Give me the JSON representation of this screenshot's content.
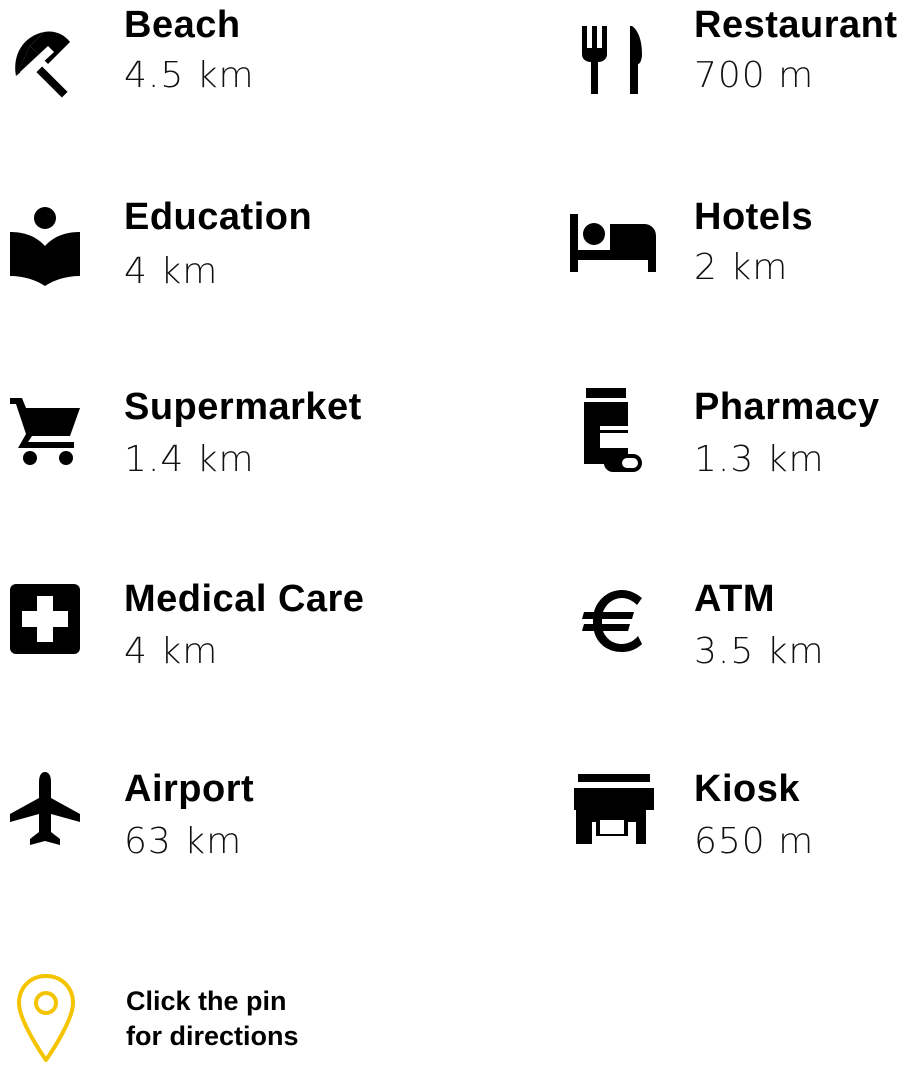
{
  "amenities": [
    {
      "name": "Beach",
      "distance": "4.5 km",
      "icon": "beach-umbrella-icon"
    },
    {
      "name": "Restaurant",
      "distance": "700 m",
      "icon": "restaurant-icon"
    },
    {
      "name": "Education",
      "distance": "4 km",
      "icon": "education-icon"
    },
    {
      "name": "Hotels",
      "distance": "2 km",
      "icon": "hotel-bed-icon"
    },
    {
      "name": "Supermarket",
      "distance": "1.4 km",
      "icon": "shopping-cart-icon"
    },
    {
      "name": "Pharmacy",
      "distance": "1.3 km",
      "icon": "pharmacy-icon"
    },
    {
      "name": "Medical Care",
      "distance": "4 km",
      "icon": "medical-cross-icon"
    },
    {
      "name": "ATM",
      "distance": "3.5 km",
      "icon": "euro-icon"
    },
    {
      "name": "Airport",
      "distance": "63 km",
      "icon": "airplane-icon"
    },
    {
      "name": "Kiosk",
      "distance": "650 m",
      "icon": "store-icon"
    }
  ],
  "pin_hint": {
    "line1": "Click the pin",
    "line2": "for directions",
    "icon": "map-pin-icon",
    "pin_color": "#F5C400"
  },
  "colors": {
    "text": "#000000",
    "background": "#FFFFFF"
  }
}
